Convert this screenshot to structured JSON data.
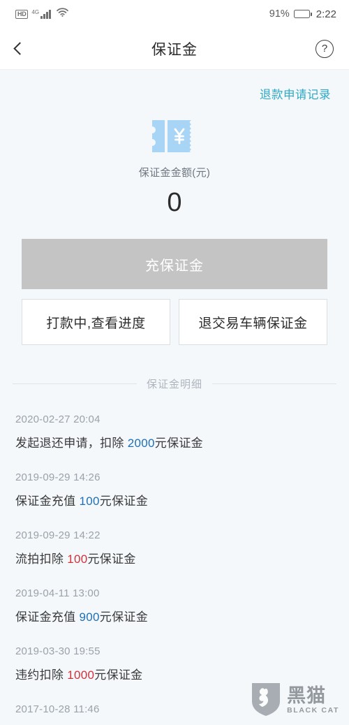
{
  "status_bar": {
    "hd_label": "HD",
    "network_label": "4G",
    "signal_icon": "signal-bars-icon",
    "wifi_icon": "wifi-icon",
    "battery_percent": "91%",
    "battery_level": 91,
    "battery_icon": "battery-icon",
    "clock": "2:22"
  },
  "nav": {
    "back_icon": "back-chevron-icon",
    "title": "保证金",
    "help_icon": "help-circle-icon",
    "help_glyph": "?"
  },
  "main": {
    "refund_link": "退款申请记录",
    "ticket_icon": "ticket-yen-icon",
    "deposit_label": "保证金金额(元)",
    "deposit_amount": "0",
    "recharge_button": "充保证金",
    "secondary_buttons": [
      "打款中,查看进度",
      "退交易车辆保证金"
    ]
  },
  "detail_section": {
    "title": "保证金明细",
    "entries": [
      {
        "time": "2020-02-27 20:04",
        "prefix": "发起退还申请，扣除 ",
        "amount": "2000",
        "suffix": "元保证金",
        "kind": "credit"
      },
      {
        "time": "2019-09-29 14:26",
        "prefix": "保证金充值 ",
        "amount": "100",
        "suffix": "元保证金",
        "kind": "credit"
      },
      {
        "time": "2019-09-29 14:22",
        "prefix": "流拍扣除 ",
        "amount": "100",
        "suffix": "元保证金",
        "kind": "debit"
      },
      {
        "time": "2019-04-11 13:00",
        "prefix": "保证金充值 ",
        "amount": "900",
        "suffix": "元保证金",
        "kind": "credit"
      },
      {
        "time": "2019-03-30 19:55",
        "prefix": "违约扣除 ",
        "amount": "1000",
        "suffix": "元保证金",
        "kind": "debit"
      },
      {
        "time": "2017-10-28 11:46",
        "prefix": "",
        "amount": "",
        "suffix": "",
        "kind": "credit"
      }
    ]
  },
  "watermark": {
    "logo_icon": "black-cat-shield-icon",
    "name_cn": "黑猫",
    "name_en": "BLACK CAT"
  },
  "colors": {
    "link": "#2fa8c6",
    "credit": "#1f6fb8",
    "debit": "#d0323c",
    "background": "#f4f8fb",
    "disabled_button": "#c4c4c4",
    "ticket_icon": "#a8d4f5"
  }
}
